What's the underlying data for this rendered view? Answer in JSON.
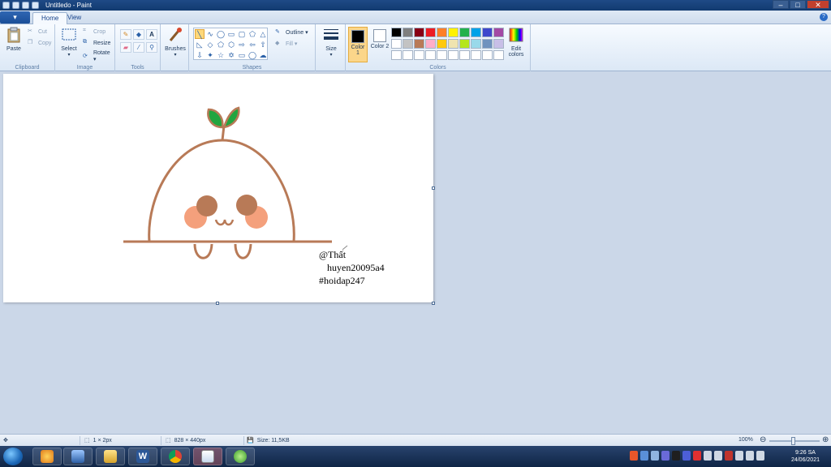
{
  "window": {
    "title": "Untitledo - Paint"
  },
  "menu": {
    "file_button": "▾"
  },
  "tabs": [
    {
      "label": "Home"
    },
    {
      "label": "View"
    }
  ],
  "ribbon": {
    "clipboard": {
      "paste": "Paste",
      "cut": "Cut",
      "copy": "Copy",
      "label": "Clipboard"
    },
    "image": {
      "select": "Select",
      "crop": "Crop",
      "resize": "Resize",
      "rotate": "Rotate ▾",
      "label": "Image"
    },
    "tools": {
      "label": "Tools",
      "text_tool": "A"
    },
    "brushes": {
      "label": "Brushes"
    },
    "shapes": {
      "outline": "Outline ▾",
      "fill": "Fill ▾",
      "label": "Shapes"
    },
    "size": {
      "label": "Size"
    },
    "colors": {
      "color1": "Color 1",
      "color2": "Color 2",
      "edit": "Edit colors",
      "label": "Colors",
      "color1_value": "#000000",
      "color2_value": "#ffffff",
      "palette": [
        "#000000",
        "#7f7f7f",
        "#880015",
        "#ed1c24",
        "#ff7f27",
        "#fff200",
        "#22b14c",
        "#00a2e8",
        "#3f48cc",
        "#a349a4",
        "#ffffff",
        "#c3c3c3",
        "#b97a57",
        "#ffaec9",
        "#ffc90e",
        "#efe4b0",
        "#b5e61d",
        "#99d9ea",
        "#7092be",
        "#c8bfe7",
        "#ffffff",
        "#ffffff",
        "#ffffff",
        "#ffffff",
        "#ffffff",
        "#ffffff",
        "#ffffff",
        "#ffffff",
        "#ffffff",
        "#ffffff"
      ]
    }
  },
  "canvas": {
    "text_line1": "@Thất",
    "text_line2": "huyen20095a4",
    "text_line3": "#hoidap247",
    "drawing_colors": {
      "outline": "#b87a57",
      "cheek": "#f4a07c",
      "eye": "#b87a57",
      "leaf": "#22a540"
    }
  },
  "statusbar": {
    "pen_size": "1 × 2px",
    "canvas_size": "828 × 440px",
    "file_size": "Size: 11,5KB",
    "zoom": "100%"
  },
  "taskbar": {
    "time": "9:26 SA",
    "date": "24/06/2021"
  }
}
